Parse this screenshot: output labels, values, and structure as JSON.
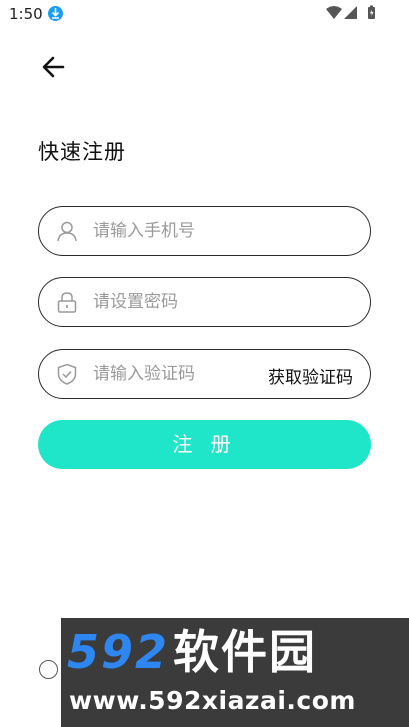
{
  "status_bar": {
    "time": "1:50",
    "icons": [
      "download-icon",
      "wifi-icon",
      "signal-icon",
      "battery-icon"
    ]
  },
  "header": {
    "back_icon": "arrow-left-icon"
  },
  "page": {
    "title": "快速注册"
  },
  "form": {
    "phone": {
      "placeholder": "请输入手机号",
      "value": "",
      "icon": "user-icon"
    },
    "password": {
      "placeholder": "请设置密码",
      "value": "",
      "icon": "lock-icon"
    },
    "code": {
      "placeholder": "请输入验证码",
      "value": "",
      "icon": "shield-icon",
      "get_code_label": "获取验证码"
    },
    "submit_label": "注 册"
  },
  "agreement": {
    "checked": false
  },
  "watermark": {
    "brand_number": "592",
    "brand_name": "软件园",
    "url": "www.592xiazai.com"
  },
  "colors": {
    "accent": "#1fe5c9",
    "download_badge": "#1a9cf0",
    "watermark_bg": "#3b3b3b",
    "watermark_blue": "#2e86f0"
  }
}
